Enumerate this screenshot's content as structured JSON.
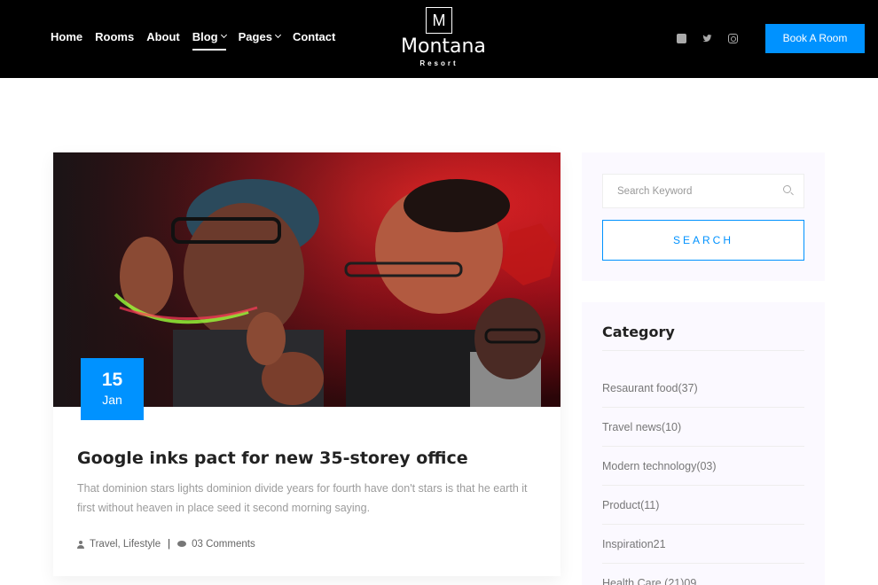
{
  "nav": {
    "items": [
      {
        "label": "Home"
      },
      {
        "label": "Rooms"
      },
      {
        "label": "About"
      },
      {
        "label": "Blog"
      },
      {
        "label": "Pages"
      },
      {
        "label": "Contact"
      }
    ],
    "active": "Blog"
  },
  "brand": {
    "mark": "M",
    "name": "Montana",
    "tagline": "Resort"
  },
  "social": [
    "facebook-icon",
    "twitter-icon",
    "instagram-icon"
  ],
  "header": {
    "book_label": "Book A Room"
  },
  "post": {
    "date_day": "15",
    "date_month": "Jan",
    "title": "Google inks pact for new 35-storey office",
    "excerpt": "That dominion stars lights dominion divide years for fourth have don't stars is that he earth it first without heaven in place seed it second morning saying.",
    "categories": "Travel, Lifestyle",
    "comments": "03 Comments"
  },
  "search": {
    "placeholder": "Search Keyword",
    "button_label": "SEARCH"
  },
  "category": {
    "title": "Category",
    "items": [
      {
        "label": "Resaurant food(37)"
      },
      {
        "label": "Travel news(10)"
      },
      {
        "label": "Modern technology(03)"
      },
      {
        "label": "Product(11)"
      },
      {
        "label": "Inspiration21"
      },
      {
        "label": "Health Care (21)09"
      }
    ]
  },
  "colors": {
    "accent": "#0092ff",
    "header_bg": "#000000",
    "sidebar_bg": "#fbf9ff"
  }
}
